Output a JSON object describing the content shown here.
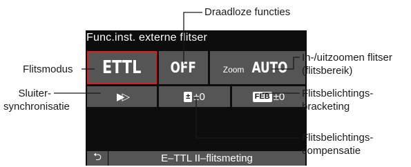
{
  "screen": {
    "title": "Func.inst. externe flitser",
    "flash_mode": "ETTL",
    "wireless": "OFF",
    "zoom_word": "Zoom",
    "zoom_value": "AUTO",
    "shutter_sync_symbol": "▶▷",
    "comp_icon": "±",
    "comp_value": "±0",
    "feb_icon": "FEB",
    "feb_value": "±0",
    "footer_back_symbol": "⮌",
    "footer_text": "E–TTL II–flitsmeting"
  },
  "callouts": {
    "wireless": "Draadloze functies",
    "flash_mode": "Flitsmodus",
    "zoom_line1": "In-/uitzoomen flitser",
    "zoom_line2": "(flitsbereik)",
    "sync_line1": "Sluiter-",
    "sync_line2": "synchronisatie",
    "feb_line1": "Flitsbelichtings-",
    "feb_line2": "bracketing",
    "comp_line1": "Flitsbelichtings-",
    "comp_line2": "compensatie"
  },
  "colors": {
    "screen_bg": "#0d0d0d",
    "cell_bg": "#555555",
    "selection_border": "#d8201c"
  }
}
